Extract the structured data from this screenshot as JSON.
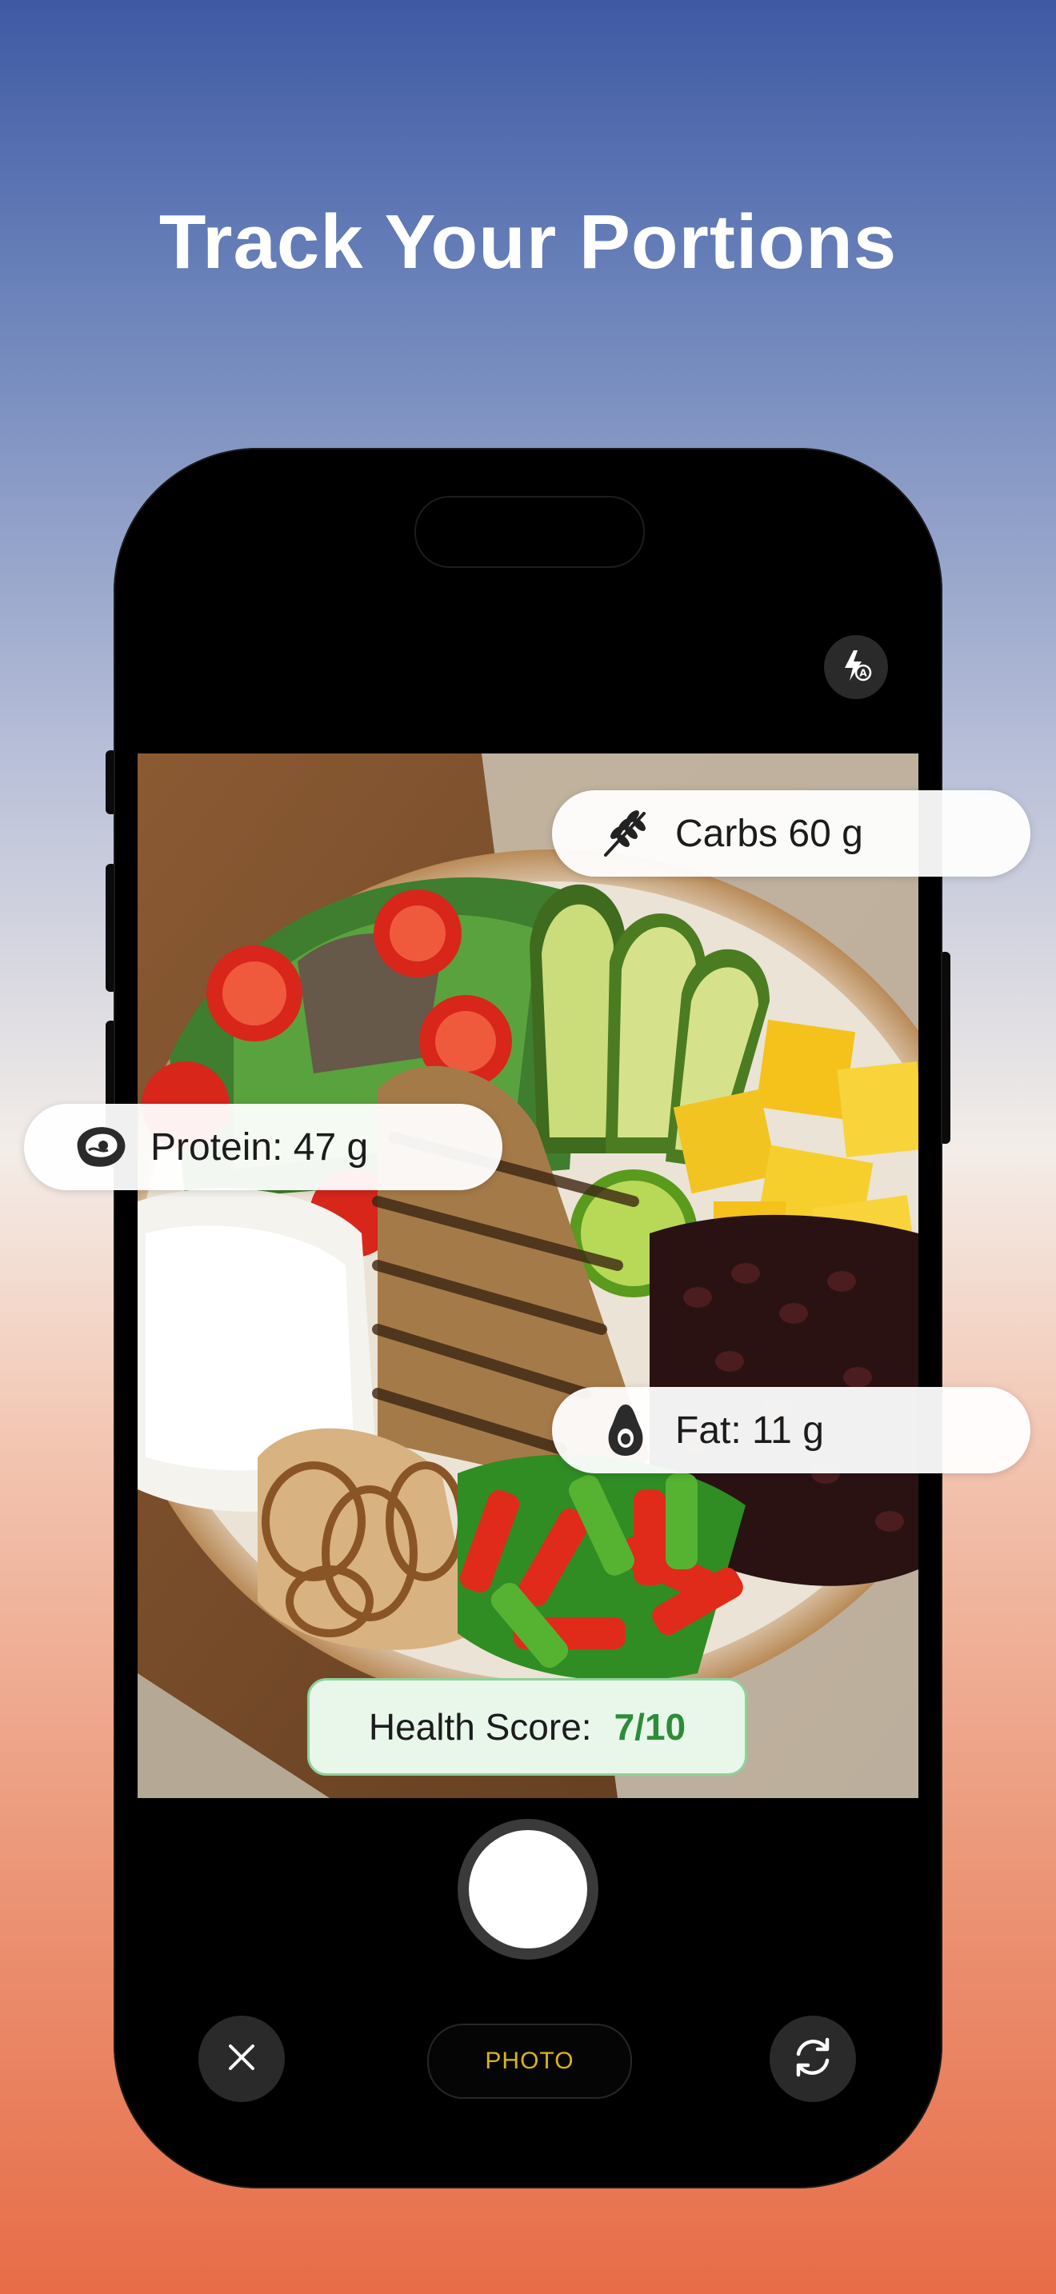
{
  "headline": "Track Your Portions",
  "camera": {
    "mode_label": "PHOTO"
  },
  "macros": {
    "carbs": {
      "label": "Carbs 60 g",
      "icon": "wheat-icon"
    },
    "protein": {
      "label": "Protein: 47 g",
      "icon": "meat-icon"
    },
    "fat": {
      "label": "Fat: 11 g",
      "icon": "avocado-icon"
    }
  },
  "health": {
    "label": "Health Score:",
    "score": "7/10",
    "score_color": "#2e8b3a"
  },
  "icons": {
    "flash": "flash-auto-icon",
    "close": "close-icon",
    "flip": "flip-camera-icon"
  }
}
